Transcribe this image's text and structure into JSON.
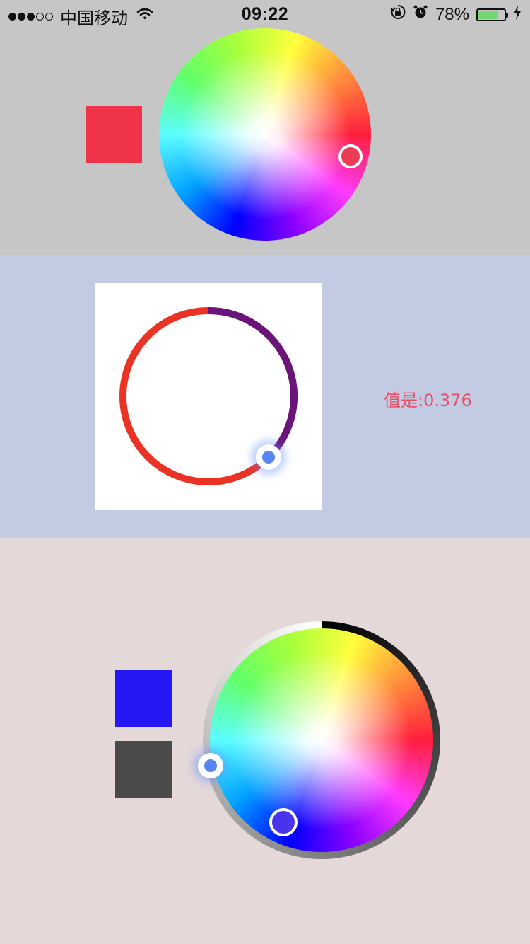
{
  "status_bar": {
    "signal_dots": [
      "filled",
      "filled",
      "filled",
      "empty",
      "empty"
    ],
    "carrier": "中国移动",
    "wifi_icon": "wifi-icon",
    "time": "09:22",
    "orientation_lock_icon": "orientation-lock-icon",
    "alarm_icon": "alarm-icon",
    "battery_percent": "78%",
    "battery_level": 0.78,
    "battery_color": "#76d672",
    "charging_icon": "charging-bolt-icon"
  },
  "section1": {
    "background": "#c6c6c6",
    "selected_color": "#ef3449",
    "handle_fill": "#ed3a55"
  },
  "section2": {
    "background": "#c2cbe2",
    "slider_value": 0.376,
    "track_colors": {
      "filled": "#6a157a",
      "remaining": "#ea3324"
    },
    "value_label": "值是:0.376"
  },
  "section3": {
    "background": "#e4d8d8",
    "selected_color": "#2518f5",
    "brightness_color": "#4a4a4a",
    "handle_fill": "#4a33ec",
    "brightness_gradient": [
      "#000000",
      "#555555",
      "#aaaaaa",
      "#ffffff"
    ]
  }
}
